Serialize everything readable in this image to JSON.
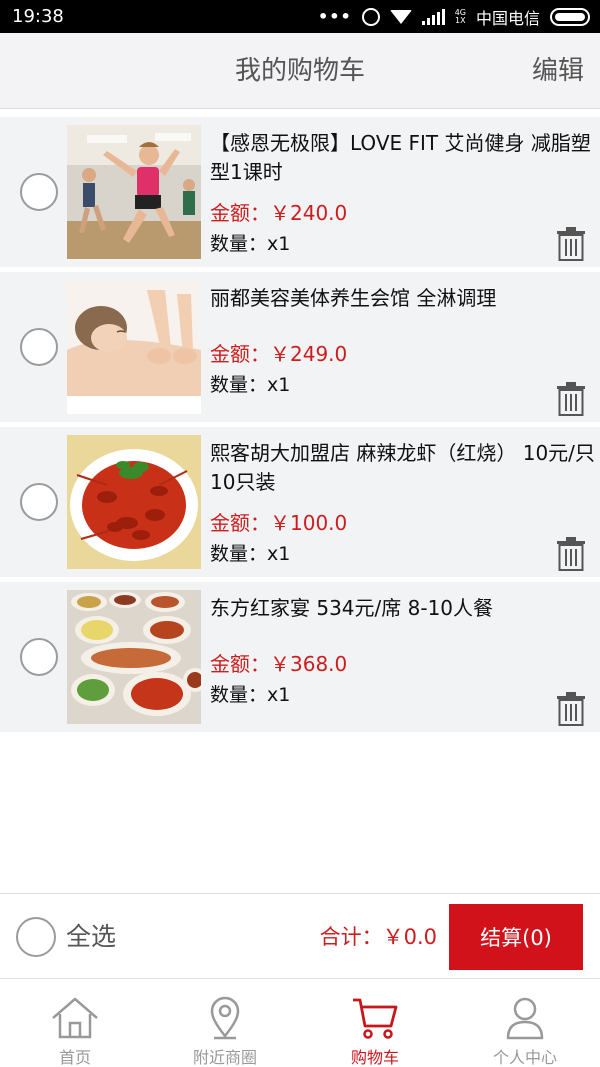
{
  "status_bar": {
    "time": "19:38",
    "network": "4G",
    "network_sub": "1X",
    "carrier": "中国电信"
  },
  "header": {
    "title": "我的购物车",
    "edit_label": "编辑"
  },
  "cart_items": [
    {
      "title": "【感恩无极限】LOVE FIT 艾尚健身 减脂塑型1课时",
      "price_label": "金额：",
      "price": "￥240.0",
      "qty_label": "数量：",
      "qty": "x1",
      "image": "fitness-class-photo"
    },
    {
      "title": "丽都美容美体养生会馆  全淋调理",
      "price_label": "金额：",
      "price": "￥249.0",
      "qty_label": "数量：",
      "qty": "x1",
      "image": "massage-photo"
    },
    {
      "title": "熙客胡大加盟店 麻辣龙虾（红烧） 10元/只  10只装",
      "price_label": "金额：",
      "price": "￥100.0",
      "qty_label": "数量：",
      "qty": "x1",
      "image": "crayfish-dish-photo"
    },
    {
      "title": "东方红家宴 534元/席 8-10人餐",
      "price_label": "金额：",
      "price": "￥368.0",
      "qty_label": "数量：",
      "qty": "x1",
      "image": "banquet-dishes-photo"
    }
  ],
  "checkout": {
    "select_all_label": "全选",
    "total_label": "合计：",
    "total_value": "￥0.0",
    "button_label": "结算(0)"
  },
  "tabs": [
    {
      "label": "首页",
      "icon": "home-icon",
      "active": false
    },
    {
      "label": "附近商圈",
      "icon": "location-pin-icon",
      "active": false
    },
    {
      "label": "购物车",
      "icon": "cart-icon",
      "active": true
    },
    {
      "label": "个人中心",
      "icon": "user-icon",
      "active": false
    }
  ],
  "colors": {
    "accent": "#d1121b",
    "price": "#cc1e1e",
    "item_background": "#f2f3f5",
    "header_background": "#f3f3f5",
    "muted_text": "#999999"
  }
}
